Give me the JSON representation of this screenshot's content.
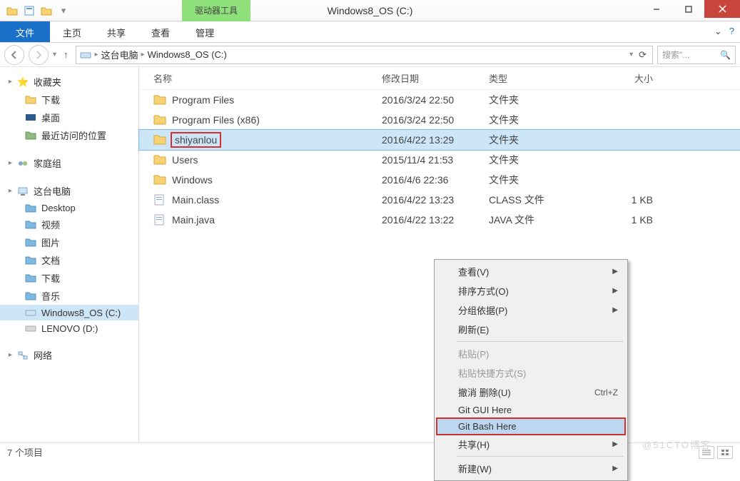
{
  "title": "Windows8_OS (C:)",
  "tooltab": "驱动器工具",
  "ribbon": {
    "file": "文件",
    "home": "主页",
    "share": "共享",
    "view": "查看",
    "manage": "管理"
  },
  "breadcrumb": {
    "root": "这台电脑",
    "path": "Windows8_OS (C:)"
  },
  "search_placeholder": "搜索\"...",
  "sidebar": {
    "favorites": {
      "label": "收藏夹",
      "items": [
        "下载",
        "桌面",
        "最近访问的位置"
      ]
    },
    "homegroup": "家庭组",
    "thispc": {
      "label": "这台电脑",
      "items": [
        "Desktop",
        "视频",
        "图片",
        "文档",
        "下载",
        "音乐",
        "Windows8_OS (C:)",
        "LENOVO (D:)"
      ]
    },
    "network": "网络"
  },
  "columns": {
    "name": "名称",
    "date": "修改日期",
    "type": "类型",
    "size": "大小"
  },
  "files": [
    {
      "name": "Program Files",
      "date": "2016/3/24 22:50",
      "type": "文件夹",
      "size": "",
      "icon": "folder"
    },
    {
      "name": "Program Files (x86)",
      "date": "2016/3/24 22:50",
      "type": "文件夹",
      "size": "",
      "icon": "folder"
    },
    {
      "name": "shiyanlou",
      "date": "2016/4/22 13:29",
      "type": "文件夹",
      "size": "",
      "icon": "folder",
      "selected": true,
      "highlighted": true
    },
    {
      "name": "Users",
      "date": "2015/11/4 21:53",
      "type": "文件夹",
      "size": "",
      "icon": "folder"
    },
    {
      "name": "Windows",
      "date": "2016/4/6 22:36",
      "type": "文件夹",
      "size": "",
      "icon": "folder"
    },
    {
      "name": "Main.class",
      "date": "2016/4/22 13:23",
      "type": "CLASS 文件",
      "size": "1 KB",
      "icon": "file"
    },
    {
      "name": "Main.java",
      "date": "2016/4/22 13:22",
      "type": "JAVA 文件",
      "size": "1 KB",
      "icon": "file"
    }
  ],
  "context_menu": [
    {
      "label": "查看(V)",
      "sub": true
    },
    {
      "label": "排序方式(O)",
      "sub": true
    },
    {
      "label": "分组依据(P)",
      "sub": true
    },
    {
      "label": "刷新(E)"
    },
    {
      "sep": true
    },
    {
      "label": "粘贴(P)",
      "disabled": true
    },
    {
      "label": "粘贴快捷方式(S)",
      "disabled": true
    },
    {
      "label": "撤消 删除(U)",
      "shortcut": "Ctrl+Z"
    },
    {
      "label": "Git GUI Here"
    },
    {
      "label": "Git Bash Here",
      "highlight": true
    },
    {
      "label": "共享(H)",
      "sub": true
    },
    {
      "sep": true
    },
    {
      "label": "新建(W)",
      "sub": true,
      "cut": true
    }
  ],
  "status": "7 个项目",
  "watermark": "@51CTO博客"
}
